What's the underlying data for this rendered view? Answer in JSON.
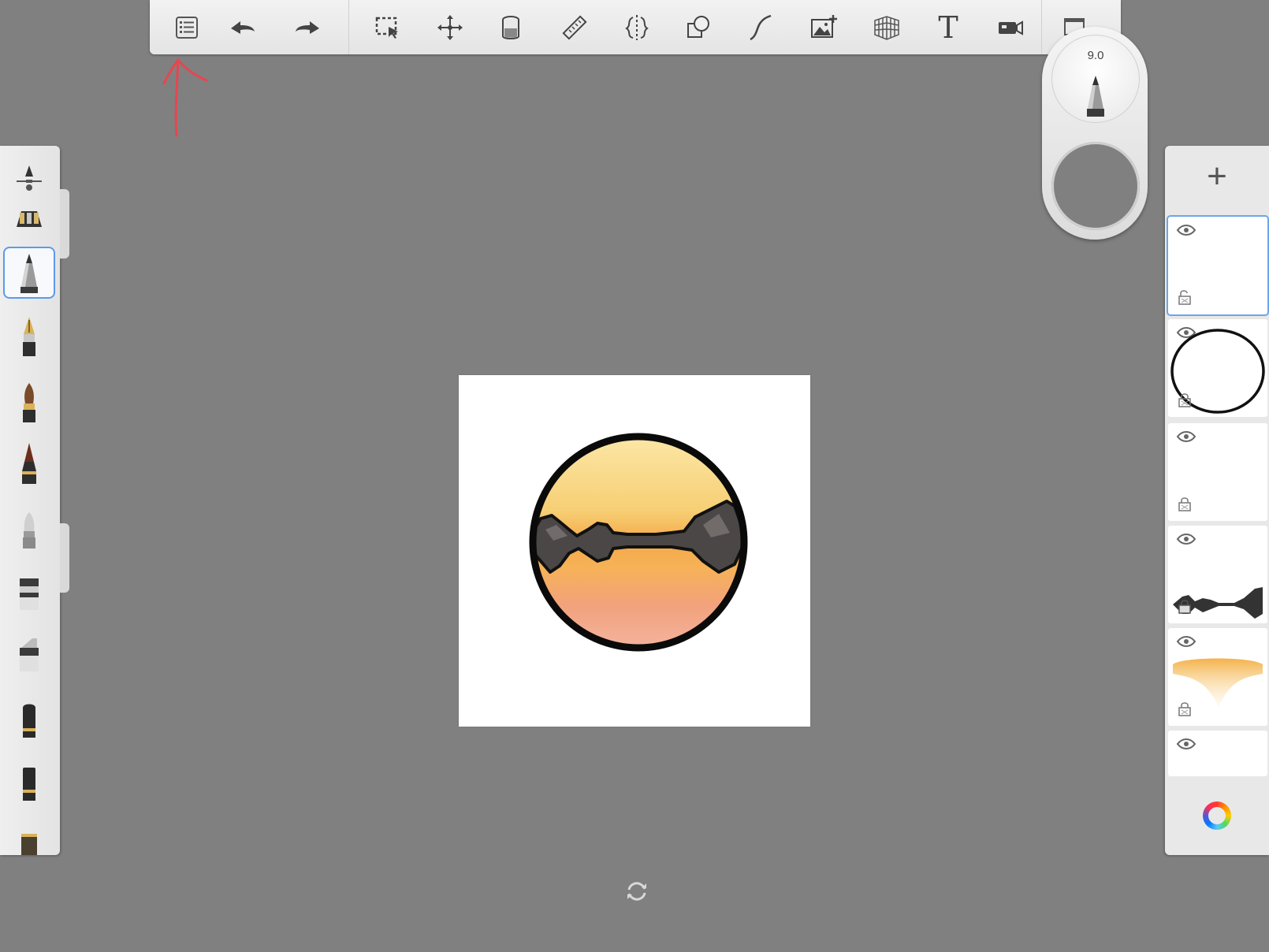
{
  "app": {
    "background": "#808080",
    "accent": "#5b9be8"
  },
  "toolbar": {
    "tools": [
      {
        "name": "menu-icon"
      },
      {
        "name": "undo-icon"
      },
      {
        "name": "redo-icon"
      },
      {
        "name": "selection-icon"
      },
      {
        "name": "transform-icon"
      },
      {
        "name": "fill-bucket-icon"
      },
      {
        "name": "ruler-icon"
      },
      {
        "name": "symmetry-icon"
      },
      {
        "name": "shapes-icon"
      },
      {
        "name": "steady-stroke-icon"
      },
      {
        "name": "import-image-icon"
      },
      {
        "name": "perspective-guide-icon"
      },
      {
        "name": "text-icon"
      },
      {
        "name": "time-lapse-icon"
      },
      {
        "name": "fullscreen-icon"
      }
    ],
    "text_tool_glyph": "T"
  },
  "puck": {
    "brush_size": "9.0",
    "current_color": "#808080"
  },
  "brushes": {
    "selected_index": 1,
    "items": [
      "brush-properties-icon",
      "airbrush-icon",
      "pencil-icon",
      "fountain-pen-icon",
      "paintbrush-icon",
      "ink-pen-icon",
      "eraser-icon",
      "marker-icon",
      "chisel-marker-icon",
      "blender-icon",
      "smudge-icon",
      "brush-more-icon"
    ]
  },
  "layers": {
    "add_label": "+",
    "items": [
      {
        "name": "layer-empty",
        "active": true
      },
      {
        "name": "layer-circle-outline",
        "active": false
      },
      {
        "name": "layer-wash",
        "active": false
      },
      {
        "name": "layer-mountains",
        "active": false
      },
      {
        "name": "layer-sunset-wash",
        "active": false
      },
      {
        "name": "layer-background",
        "active": false
      }
    ]
  },
  "annotation": {
    "color": "#e8454f"
  }
}
